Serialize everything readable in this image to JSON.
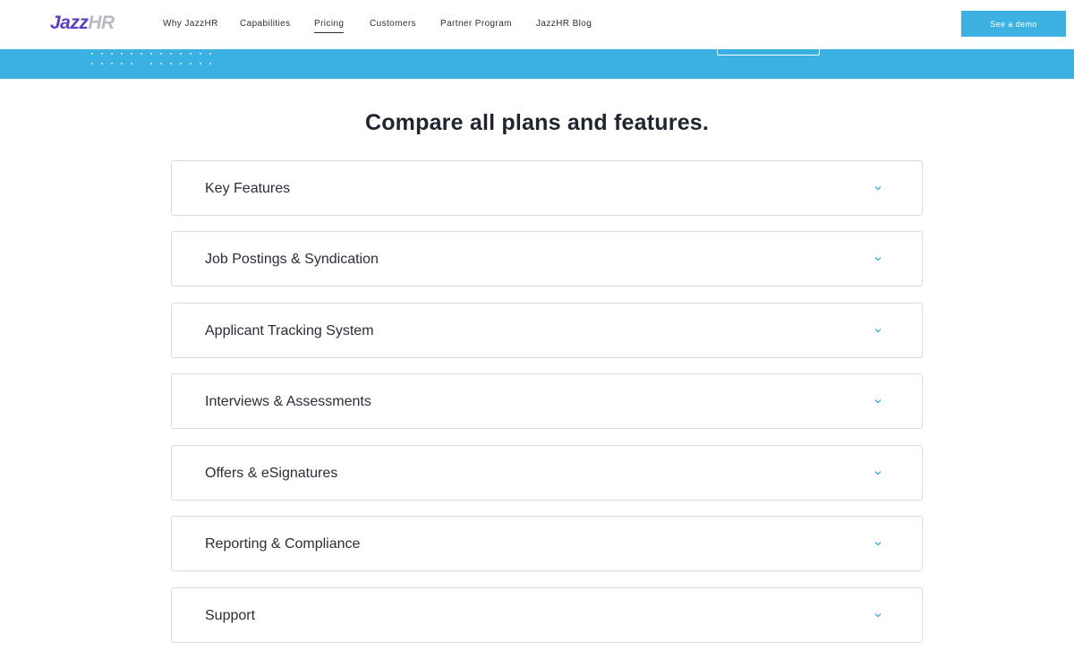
{
  "header": {
    "logo": {
      "part1": "Jazz",
      "part2": "HR"
    },
    "nav": [
      {
        "label": "Why JazzHR",
        "active": false
      },
      {
        "label": "Capabilities",
        "active": false
      },
      {
        "label": "Pricing",
        "active": true
      },
      {
        "label": "Customers",
        "active": false
      },
      {
        "label": "Partner Program",
        "active": false
      },
      {
        "label": "JazzHR Blog",
        "active": false
      }
    ],
    "demo_button": "See a demo"
  },
  "colors": {
    "accent": "#3eb1e3",
    "band": "#3ab1e2",
    "logo_primary": "#5b3ec8",
    "logo_secondary": "#b8bac6"
  },
  "compare": {
    "title": "Compare all plans and features.",
    "sections": [
      {
        "label": "Key Features",
        "icon": "chevron-down-icon"
      },
      {
        "label": "Job Postings & Syndication",
        "icon": "chevron-down-icon"
      },
      {
        "label": "Applicant Tracking System",
        "icon": "chevron-down-icon"
      },
      {
        "label": "Interviews & Assessments",
        "icon": "chevron-down-icon"
      },
      {
        "label": "Offers & eSignatures",
        "icon": "chevron-down-icon"
      },
      {
        "label": "Reporting & Compliance",
        "icon": "chevron-down-icon"
      },
      {
        "label": "Support",
        "icon": "chevron-down-icon"
      }
    ]
  }
}
